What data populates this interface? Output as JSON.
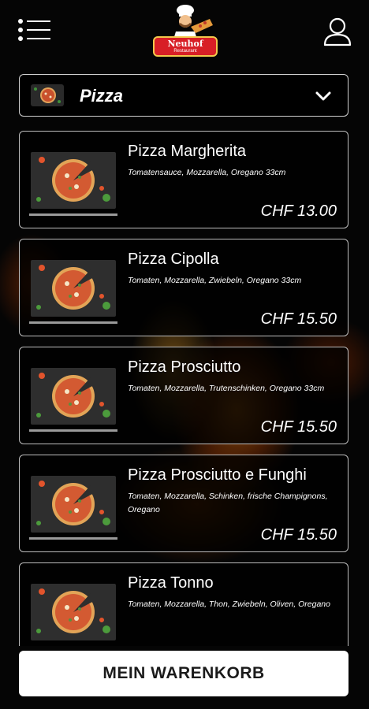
{
  "header": {
    "logo": {
      "name": "Neuhof",
      "subtitle": "Restaurant"
    }
  },
  "category": {
    "label": "Pizza"
  },
  "products": [
    {
      "name": "Pizza Margherita",
      "description": "Tomatensauce, Mozzarella, Oregano 33cm",
      "price": "CHF 13.00"
    },
    {
      "name": "Pizza Cipolla",
      "description": "Tomaten, Mozzarella, Zwiebeln, Oregano 33cm",
      "price": "CHF 15.50"
    },
    {
      "name": "Pizza Prosciutto",
      "description": "Tomaten, Mozzarella, Trutenschinken, Oregano 33cm",
      "price": "CHF 15.50"
    },
    {
      "name": "Pizza Prosciutto e Funghi",
      "description": "Tomaten, Mozzarella, Schinken, frische Champignons, Oregano",
      "price": "CHF 15.50"
    },
    {
      "name": "Pizza Tonno",
      "description": "Tomaten, Mozzarella, Thon, Zwiebeln, Oliven, Oregano",
      "price": ""
    }
  ],
  "cart": {
    "label": "MEIN WARENKORB"
  },
  "colors": {
    "background": "#050505",
    "logo_red": "#d81f26",
    "card_border": "#bdbdbd",
    "button_bg": "#ffffff"
  }
}
